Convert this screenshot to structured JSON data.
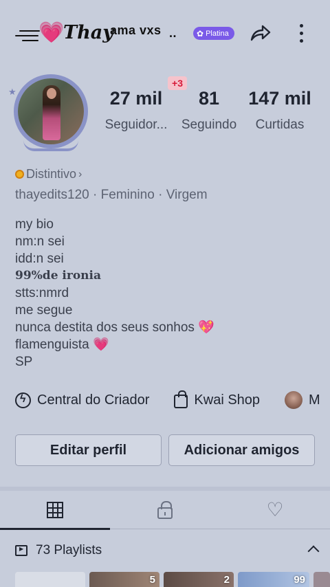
{
  "header": {
    "heart_logo": "💗",
    "name_script": "Thay",
    "name_sub": "ama vxs",
    "name_ellipsis": "..",
    "badge_label": "Platina",
    "share_icon": "share-icon",
    "more_icon": "more-icon"
  },
  "profile": {
    "new_followers_badge": "+3",
    "stats": [
      {
        "value": "27 mil",
        "label": "Seguidor..."
      },
      {
        "value": "81",
        "label": "Seguindo"
      },
      {
        "value": "147 mil",
        "label": "Curtidas"
      }
    ],
    "distintivo_label": "Distintivo",
    "distintivo_chevron": "›",
    "username": "thayedits120",
    "gender": "Feminino",
    "sign": "Virgem",
    "separator": "·",
    "bio": [
      "my bio",
      "nm:n sei",
      "idd:n sei",
      "99%de ironia",
      "stts:nmrd",
      "me segue",
      "nunca destita dos seus sonhos 💖",
      "flamenguista 💗",
      "SP"
    ]
  },
  "creator_row": {
    "creator_center": "Central do Criador",
    "kwai_shop": "Kwai Shop",
    "third_item": "M"
  },
  "buttons": {
    "edit_profile": "Editar perfil",
    "add_friends": "Adicionar amigos"
  },
  "tabs": [
    "grid-icon",
    "lock-icon",
    "heart-icon"
  ],
  "playlists": {
    "label": "73 Playlists",
    "thumb_counts": [
      "5",
      "2",
      "99"
    ]
  }
}
